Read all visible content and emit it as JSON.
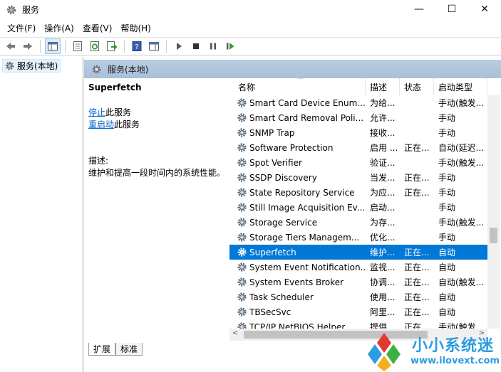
{
  "window": {
    "title": "服务",
    "minimize_glyph": "—",
    "maximize_glyph": "☐",
    "close_glyph": "✕"
  },
  "menu": [
    "文件(F)",
    "操作(A)",
    "查看(V)",
    "帮助(H)"
  ],
  "tree": {
    "root_label": "服务(本地)"
  },
  "panel": {
    "header": "服务(本地)",
    "selected_title": "Superfetch",
    "stop_link": "停止",
    "stop_suffix": "此服务",
    "restart_link": "重启动",
    "restart_suffix": "此服务",
    "desc_label": "描述:",
    "desc_text": "维护和提高一段时间内的系统性能。"
  },
  "columns": {
    "name": "名称",
    "desc": "描述",
    "status": "状态",
    "start": "启动类型"
  },
  "rows": [
    {
      "name": "Smart Card Device Enum...",
      "desc": "为给...",
      "status": "",
      "start": "手动(触发..."
    },
    {
      "name": "Smart Card Removal Poli...",
      "desc": "允许...",
      "status": "",
      "start": "手动"
    },
    {
      "name": "SNMP Trap",
      "desc": "接收...",
      "status": "",
      "start": "手动"
    },
    {
      "name": "Software Protection",
      "desc": "启用 ...",
      "status": "正在...",
      "start": "自动(延迟..."
    },
    {
      "name": "Spot Verifier",
      "desc": "验证...",
      "status": "",
      "start": "手动(触发..."
    },
    {
      "name": "SSDP Discovery",
      "desc": "当发...",
      "status": "正在...",
      "start": "手动"
    },
    {
      "name": "State Repository Service",
      "desc": "为应...",
      "status": "正在...",
      "start": "手动"
    },
    {
      "name": "Still Image Acquisition Ev...",
      "desc": "启动...",
      "status": "",
      "start": "手动"
    },
    {
      "name": "Storage Service",
      "desc": "为存...",
      "status": "",
      "start": "手动(触发..."
    },
    {
      "name": "Storage Tiers Managem...",
      "desc": "优化...",
      "status": "",
      "start": "手动"
    },
    {
      "name": "Superfetch",
      "desc": "维护...",
      "status": "正在...",
      "start": "自动",
      "selected": true
    },
    {
      "name": "System Event Notification...",
      "desc": "监视...",
      "status": "正在...",
      "start": "自动"
    },
    {
      "name": "System Events Broker",
      "desc": "协调...",
      "status": "正在...",
      "start": "自动(触发..."
    },
    {
      "name": "Task Scheduler",
      "desc": "使用...",
      "status": "正在...",
      "start": "自动"
    },
    {
      "name": "TBSecSvc",
      "desc": "阿里...",
      "status": "正在...",
      "start": "自动"
    },
    {
      "name": "TCP/IP NetBIOS Helper",
      "desc": "提供...",
      "status": "正在...",
      "start": "手动(触发..."
    }
  ],
  "tabs": [
    "扩展",
    "标准"
  ],
  "watermark": {
    "title": "小小系统迷",
    "url": "www.ilovext.com"
  },
  "colors": {
    "selection": "#0078d7",
    "link": "#0066cc",
    "header_bar": "#adc4dc",
    "watermark": "#2b9de0"
  }
}
